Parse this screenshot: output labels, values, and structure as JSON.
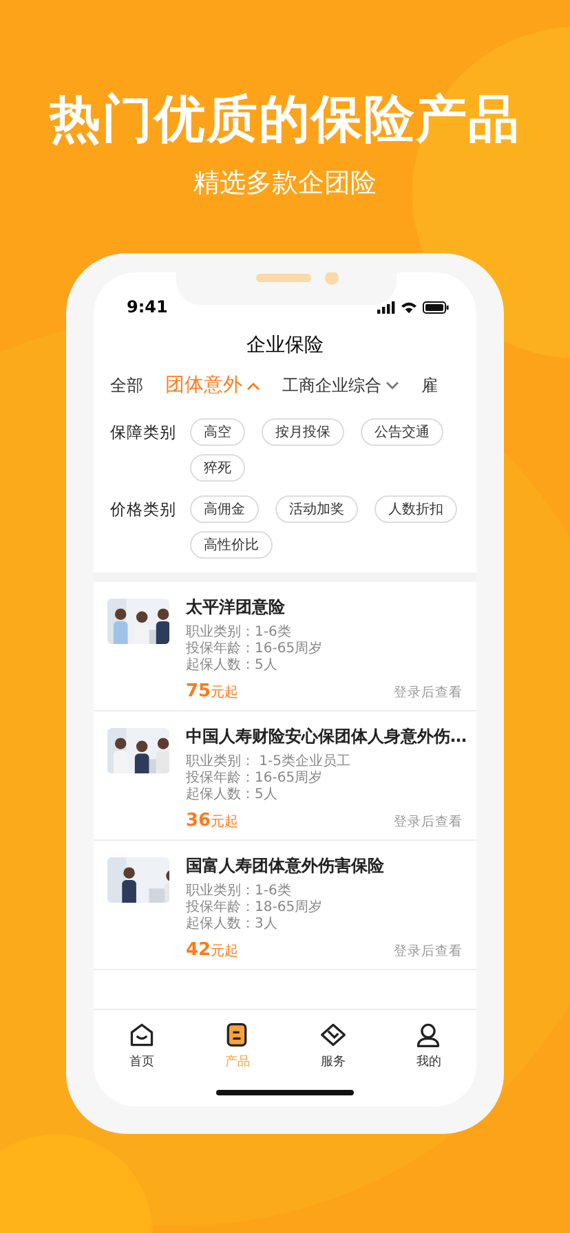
{
  "promo": {
    "headline": "热门优质的保险产品",
    "subtitle": "精选多款企团险"
  },
  "status_bar": {
    "time": "9:41"
  },
  "nav": {
    "title": "企业保险"
  },
  "category_tabs": [
    {
      "label": "全部",
      "kind": "plain",
      "selected": false
    },
    {
      "label": "团体意外",
      "kind": "dropdown",
      "selected": true,
      "expanded": true
    },
    {
      "label": "工商企业综合",
      "kind": "dropdown",
      "selected": false,
      "expanded": false
    },
    {
      "label": "雇",
      "kind": "plain",
      "selected": false
    }
  ],
  "filters": [
    {
      "label": "保障类别",
      "tags": [
        "高空",
        "按月投保",
        "公告交通",
        "猝死"
      ]
    },
    {
      "label": "价格类别",
      "tags": [
        "高佣金",
        "活动加奖",
        "人数折扣",
        "高性价比"
      ]
    }
  ],
  "products": [
    {
      "name": "太平洋团意险",
      "info": [
        "职业类别：1-6类",
        "投保年龄：16-65周岁",
        "起保人数：5人"
      ],
      "price": "75",
      "unit": "元起",
      "action": "登录后查看"
    },
    {
      "name": "中国人寿财险安心保团体人身意外伤…",
      "info": [
        "职业类别： 1-5类企业员工",
        "投保年龄：16-65周岁",
        "起保人数：5人"
      ],
      "price": "36",
      "unit": "元起",
      "action": "登录后查看"
    },
    {
      "name": "国富人寿团体意外伤害保险",
      "info": [
        "职业类别：1-6类",
        "投保年龄：18-65周岁",
        "起保人数：3人"
      ],
      "price": "42",
      "unit": "元起",
      "action": "登录后查看"
    }
  ],
  "tab_bar": [
    {
      "label": "首页",
      "kind": "home",
      "selected": false
    },
    {
      "label": "产品",
      "kind": "product",
      "selected": true
    },
    {
      "label": "服务",
      "kind": "service",
      "selected": false
    },
    {
      "label": "我的",
      "kind": "profile",
      "selected": false
    }
  ]
}
